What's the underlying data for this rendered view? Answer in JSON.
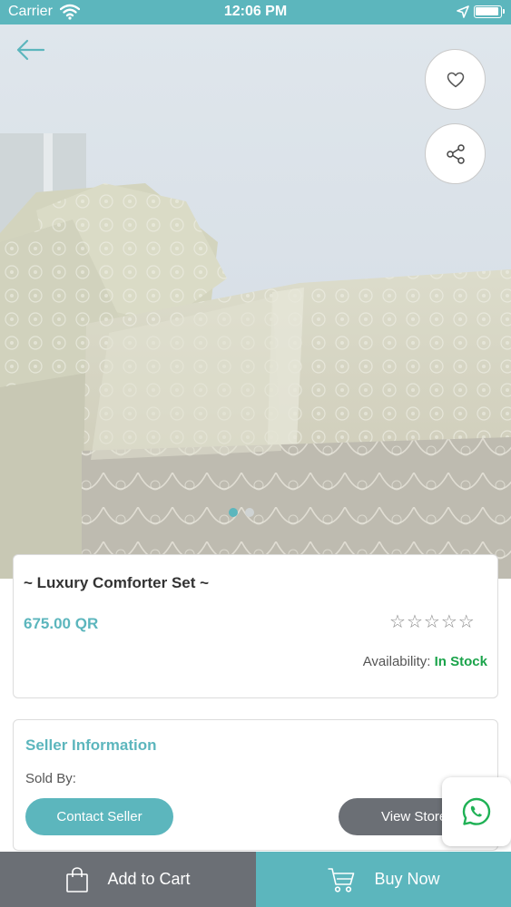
{
  "status_bar": {
    "carrier": "Carrier",
    "time": "12:06 PM",
    "icons": [
      "wifi-icon",
      "location-icon",
      "battery-icon"
    ]
  },
  "header": {
    "back_icon": "arrow-left-icon",
    "favorite_icon": "heart-icon",
    "share_icon": "share-icon"
  },
  "gallery": {
    "image": "comforter-set-photo",
    "page_count": 2,
    "active_index": 0
  },
  "product": {
    "title": "~ Luxury Comforter Set ~",
    "price": "675.00 QR",
    "rating": 0,
    "rating_max": 5,
    "stars": [
      "☆",
      "☆",
      "☆",
      "☆",
      "☆"
    ],
    "availability_label": "Availability:",
    "availability_value": "In Stock"
  },
  "seller": {
    "title": "Seller Information",
    "sold_by_label": "Sold By:",
    "contact_label": "Contact Seller",
    "view_store_label": "View Store"
  },
  "floating": {
    "whatsapp_icon": "whatsapp-icon"
  },
  "bottom_bar": {
    "add_to_cart_label": "Add to Cart",
    "buy_now_label": "Buy Now"
  },
  "colors": {
    "primary": "#5cb6bd",
    "secondary": "#6b6f75",
    "in_stock": "#1aa34a",
    "whatsapp": "#1fb155"
  }
}
